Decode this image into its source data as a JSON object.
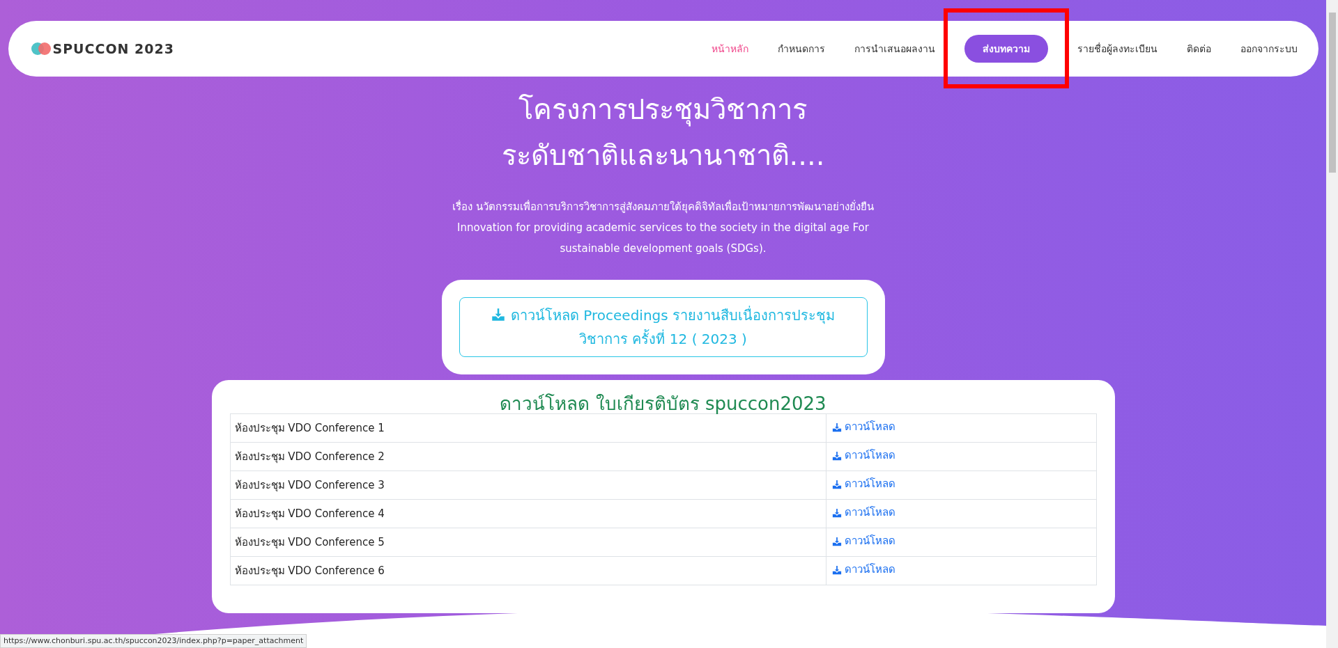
{
  "navbar": {
    "logo_text": "SPUCCON 2023",
    "items": [
      {
        "label": "หน้าหลัก",
        "selected": true,
        "kind": "link"
      },
      {
        "label": "กำหนดการ",
        "selected": false,
        "kind": "link"
      },
      {
        "label": "การนำเสนอผลงาน",
        "selected": false,
        "kind": "link"
      },
      {
        "label": "ส่งบทความ",
        "selected": false,
        "kind": "button"
      },
      {
        "label": "รายชื่อผู้ลงทะเบียน",
        "selected": false,
        "kind": "link"
      },
      {
        "label": "ติดต่อ",
        "selected": false,
        "kind": "link"
      },
      {
        "label": "ออกจากระบบ",
        "selected": false,
        "kind": "link"
      }
    ]
  },
  "hero": {
    "title_lines": [
      "โครงการประชุมวิชาการ",
      "ระดับชาติและนานาชาติ...."
    ],
    "description": "เรื่อง นวัตกรรมเพื่อการบริการวิชาการสู่สังคมภายใต้ยุคดิจิทัลเพื่อเป้าหมายการพัฒนาอย่างยั่งยืน Innovation for providing academic services to the society in the digital age For sustainable development goals (SDGs)."
  },
  "proceedings_button": "ดาวน์โหลด Proceedings รายงานสืบเนื่องการประชุมวิชาการ ครั้งที่ 12 ( 2023 )",
  "certificates": {
    "title": "ดาวน์โหลด ใบเกียรติบัตร spuccon2023",
    "rows": [
      {
        "room": "ห้องประชุม VDO Conference 1",
        "link": "ดาวน์โหลด"
      },
      {
        "room": "ห้องประชุม VDO Conference 2",
        "link": "ดาวน์โหลด"
      },
      {
        "room": "ห้องประชุม VDO Conference 3",
        "link": "ดาวน์โหลด"
      },
      {
        "room": "ห้องประชุม VDO Conference 4",
        "link": "ดาวน์โหลด"
      },
      {
        "room": "ห้องประชุม VDO Conference 5",
        "link": "ดาวน์โหลด"
      },
      {
        "room": "ห้องประชุม VDO Conference 6",
        "link": "ดาวน์โหลด"
      }
    ]
  },
  "status_bar": "https://www.chonburi.spu.ac.th/spuccon2023/index.php?p=paper_attachment"
}
